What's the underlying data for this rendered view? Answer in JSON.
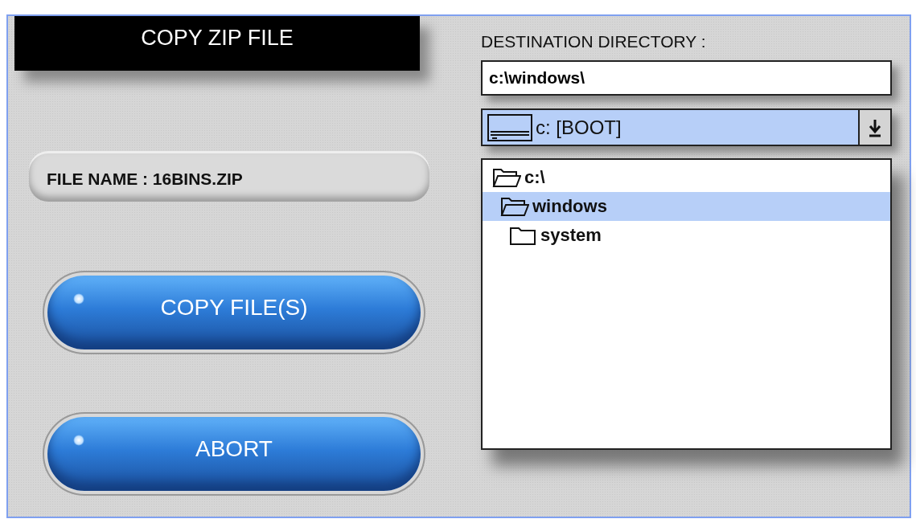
{
  "title": "COPY ZIP FILE",
  "file_name": "FILE NAME : 16BINS.ZIP",
  "buttons": [
    {
      "label": "COPY FILE(S)"
    },
    {
      "label": "ABORT"
    }
  ],
  "destination": {
    "label": "DESTINATION DIRECTORY :",
    "value": "c:\\windows\\",
    "drive": "c: [BOOT]"
  },
  "tree": [
    {
      "label": "c:\\",
      "kind": "open",
      "selected": false,
      "children": [
        {
          "label": "windows",
          "kind": "open",
          "selected": true,
          "children": [
            {
              "label": "system",
              "kind": "closed",
              "selected": false
            }
          ]
        }
      ]
    }
  ]
}
